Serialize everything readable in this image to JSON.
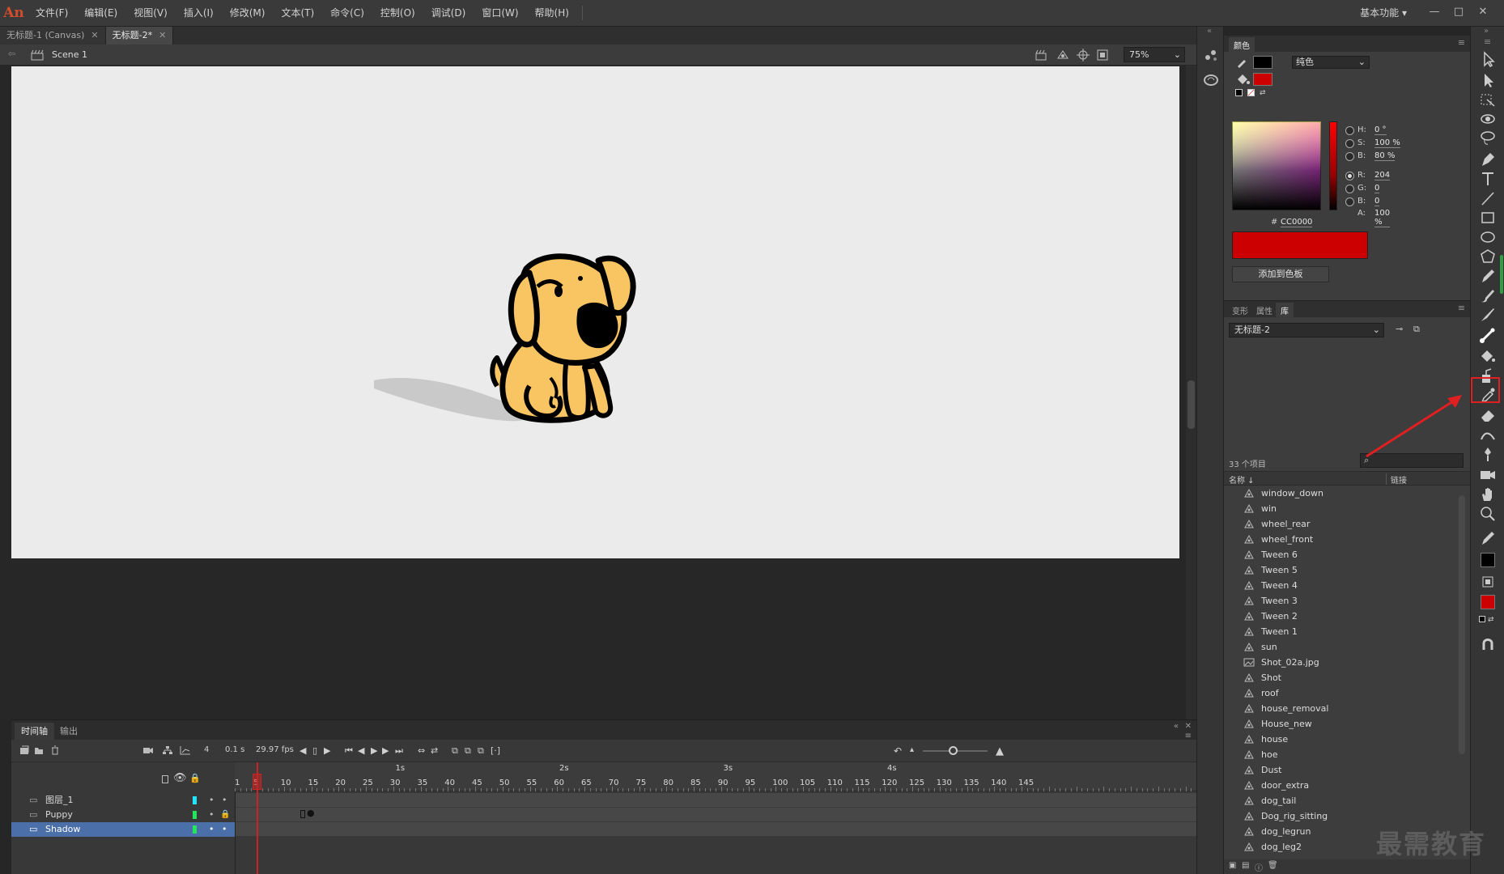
{
  "app": {
    "logo": "An",
    "workspace": "基本功能 ▾"
  },
  "menu": [
    "文件(F)",
    "编辑(E)",
    "视图(V)",
    "插入(I)",
    "修改(M)",
    "文本(T)",
    "命令(C)",
    "控制(O)",
    "调试(D)",
    "窗口(W)",
    "帮助(H)"
  ],
  "window_buttons": [
    "—",
    "□",
    "✕"
  ],
  "doc_tabs": [
    {
      "label": "无标题-1 (Canvas)",
      "active": false
    },
    {
      "label": "无标题-2*",
      "active": true
    }
  ],
  "scene": {
    "name": "Scene 1",
    "zoom": "75%"
  },
  "timeline": {
    "tabs": [
      "时间轴",
      "输出"
    ],
    "current_frame": "4",
    "time": "0.1 s",
    "fps": "29.97 fps",
    "seconds": [
      "1s",
      "2s",
      "3s",
      "4s"
    ],
    "frame_numbers": [
      "1",
      "5",
      "10",
      "15",
      "20",
      "25",
      "30",
      "35",
      "40",
      "45",
      "50",
      "55",
      "60",
      "65",
      "70",
      "75",
      "80",
      "85",
      "90",
      "95",
      "100",
      "105",
      "110",
      "115",
      "120",
      "125",
      "130",
      "135",
      "140",
      "145"
    ],
    "layers": [
      {
        "name": "图层_1",
        "color": "#1ee6ff",
        "selected": false,
        "locked": false
      },
      {
        "name": "Puppy",
        "color": "#22e65a",
        "selected": false,
        "locked": true
      },
      {
        "name": "Shadow",
        "color": "#22e65a",
        "selected": true,
        "locked": false
      }
    ]
  },
  "color_panel": {
    "title": "颜色",
    "fill_type": "纯色",
    "stroke_color": "#000000",
    "fill_color": "#cc0000",
    "fields": [
      {
        "label": "H:",
        "value": "0 °",
        "selected": false
      },
      {
        "label": "S:",
        "value": "100 %",
        "selected": false
      },
      {
        "label": "B:",
        "value": "80 %",
        "selected": false
      },
      {
        "label": "R:",
        "value": "204",
        "selected": true
      },
      {
        "label": "G:",
        "value": "0",
        "selected": false
      },
      {
        "label": "B:",
        "value": "0",
        "selected": false
      }
    ],
    "hex_label": "#",
    "hex": "CC0000",
    "alpha_label": "A:",
    "alpha": "100 %",
    "add_button": "添加到色板"
  },
  "library": {
    "tabs": [
      "变形",
      "属性",
      "库"
    ],
    "active_tab": "库",
    "document": "无标题-2",
    "count": "33 个项目",
    "col_name": "名称 ↓",
    "col_link": "链接",
    "items": [
      {
        "name": "window_down",
        "type": "symbol"
      },
      {
        "name": "win",
        "type": "symbol"
      },
      {
        "name": "wheel_rear",
        "type": "symbol"
      },
      {
        "name": "wheel_front",
        "type": "symbol"
      },
      {
        "name": "Tween 6",
        "type": "symbol"
      },
      {
        "name": "Tween 5",
        "type": "symbol"
      },
      {
        "name": "Tween 4",
        "type": "symbol"
      },
      {
        "name": "Tween 3",
        "type": "symbol"
      },
      {
        "name": "Tween 2",
        "type": "symbol"
      },
      {
        "name": "Tween 1",
        "type": "symbol"
      },
      {
        "name": "sun",
        "type": "symbol"
      },
      {
        "name": "Shot_02a.jpg",
        "type": "bitmap"
      },
      {
        "name": "Shot",
        "type": "symbol"
      },
      {
        "name": "roof",
        "type": "symbol"
      },
      {
        "name": "house_removal",
        "type": "symbol"
      },
      {
        "name": "House_new",
        "type": "symbol"
      },
      {
        "name": "house",
        "type": "symbol"
      },
      {
        "name": "hoe",
        "type": "symbol"
      },
      {
        "name": "Dust",
        "type": "symbol"
      },
      {
        "name": "door_extra",
        "type": "symbol"
      },
      {
        "name": "dog_tail",
        "type": "symbol"
      },
      {
        "name": "Dog_rig_sitting",
        "type": "symbol"
      },
      {
        "name": "dog_legrun",
        "type": "symbol"
      },
      {
        "name": "dog_leg2",
        "type": "symbol"
      }
    ]
  },
  "watermark": "最需教育",
  "colors": {
    "accent_red": "#e02020",
    "selection_blue": "#4b6fa8",
    "puppy_fill": "#f9c562"
  }
}
